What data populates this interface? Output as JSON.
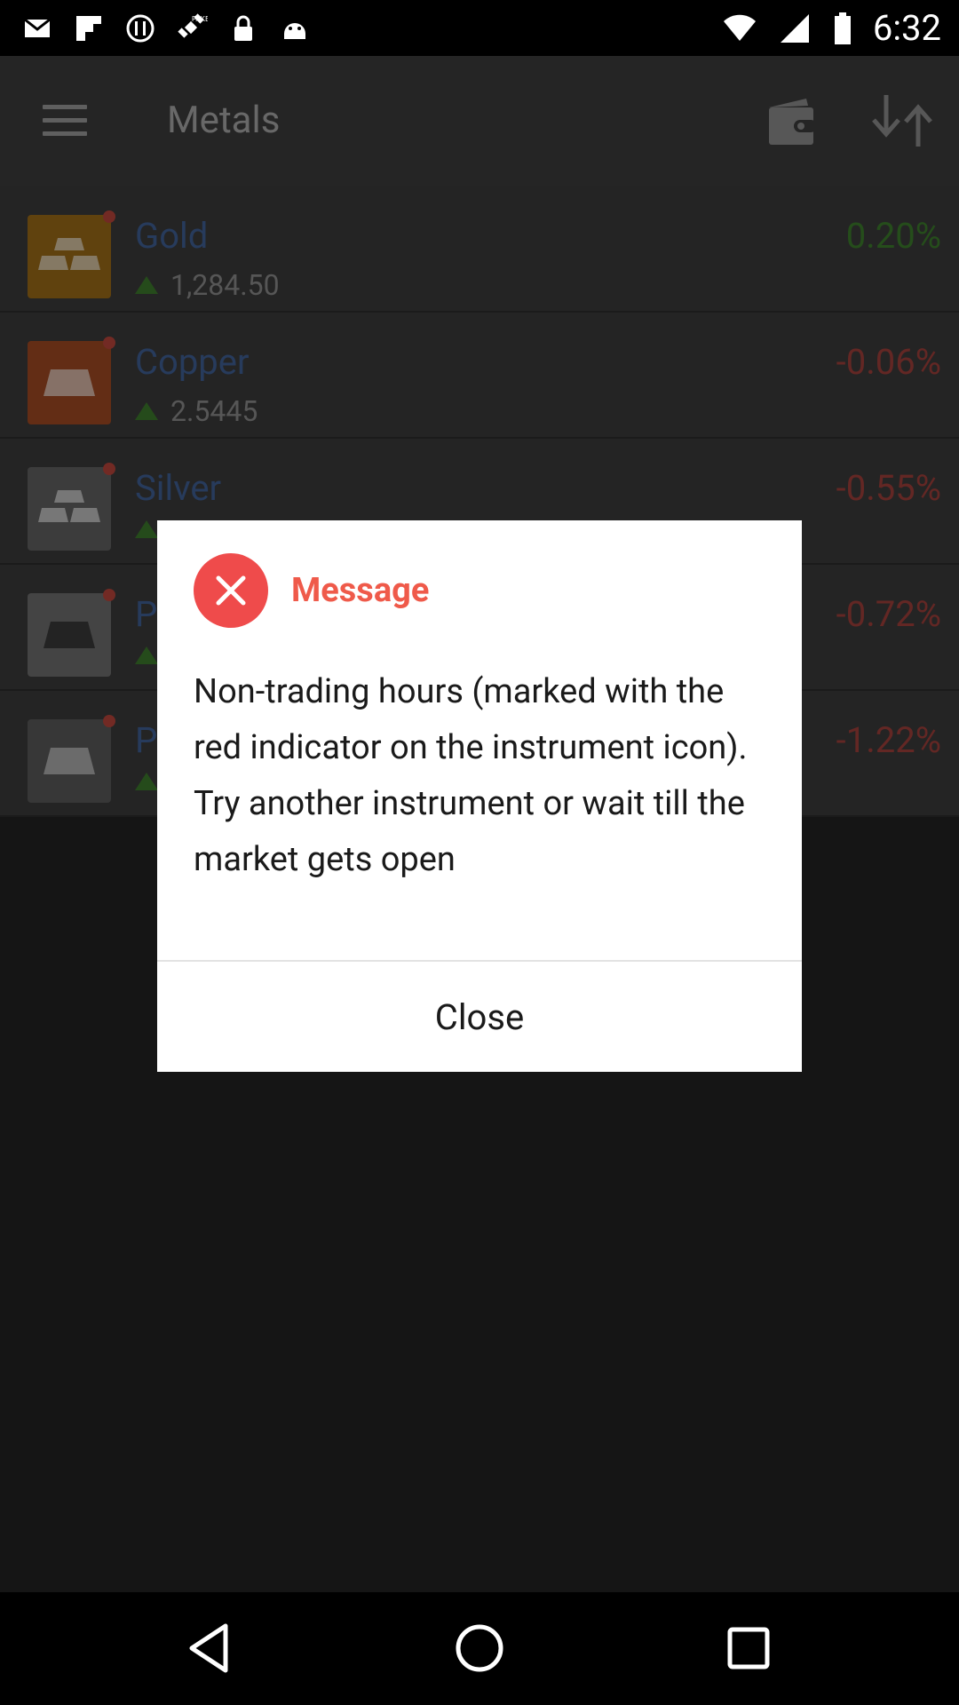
{
  "status_bar": {
    "time": "6:32",
    "left_icons": [
      "mail-icon",
      "flipboard-icon",
      "circle-sync-icon",
      "satellite-fake-gps-icon",
      "lock-icon",
      "android-icon"
    ],
    "right_icons": [
      "wifi-icon",
      "signal-icon",
      "battery-icon"
    ]
  },
  "app_bar": {
    "title": "Metals",
    "icons": [
      "menu-icon",
      "wallet-icon",
      "sort-icon"
    ]
  },
  "instruments": [
    {
      "name": "Gold",
      "price": "1,284.50",
      "change": "0.20%",
      "direction": "positive",
      "icon_color": "#9c6b18",
      "icon": "gold-bars-icon"
    },
    {
      "name": "Copper",
      "price": "2.5445",
      "change": "-0.06%",
      "direction": "negative",
      "icon_color": "#a04a23",
      "icon": "copper-bar-icon"
    },
    {
      "name": "Silver",
      "price": "",
      "change": "-0.55%",
      "direction": "negative",
      "icon_color": "#626262",
      "icon": "silver-bars-icon"
    },
    {
      "name": "P",
      "price": "",
      "change": "-0.72%",
      "direction": "negative",
      "icon_color": "#6e6e6e",
      "icon": "platinum-bar-icon"
    },
    {
      "name": "P",
      "price": "",
      "change": "-1.22%",
      "direction": "negative",
      "icon_color": "#5a5a5a",
      "icon": "palladium-bar-icon"
    }
  ],
  "dialog": {
    "title": "Message",
    "icon": "error-close-icon",
    "body": "Non-trading hours (marked with the red indicator on the instrument icon). Try another instrument or wait till the market gets open",
    "close_label": "Close"
  },
  "colors": {
    "positive": "#3d7d2d",
    "negative": "#a0403a",
    "error_red": "#ef4b4b",
    "title_red": "#ef5a4a",
    "link_blue": "#3f5f95"
  },
  "nav_bar": {
    "icons": [
      "back-icon",
      "home-icon",
      "recents-icon"
    ]
  }
}
